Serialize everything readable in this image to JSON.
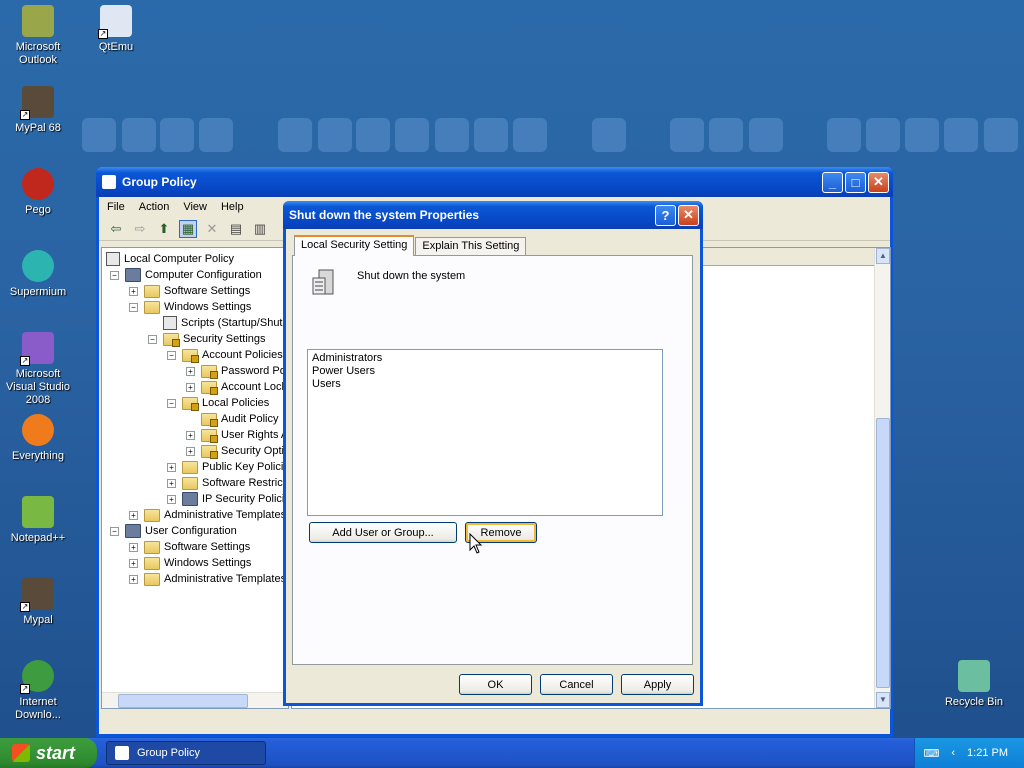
{
  "desktop": {
    "icons": [
      {
        "label": "Microsoft Outlook",
        "color": "#9aa64a"
      },
      {
        "label": "QtEmu",
        "color": "#dfe7f2"
      },
      {
        "label": "MyPal 68",
        "color": "#5a4a3a"
      },
      {
        "label": "Pego",
        "color": "#c0281e"
      },
      {
        "label": "Supermium",
        "color": "#2cb5b0"
      },
      {
        "label": "Microsoft Visual Studio 2008",
        "color": "#8a5cc9"
      },
      {
        "label": "Everything",
        "color": "#ef7b1d"
      },
      {
        "label": "Notepad++",
        "color": "#79b843"
      },
      {
        "label": "Mypal",
        "color": "#5a4a3a"
      },
      {
        "label": "Internet Downlo...",
        "color": "#3f9b3f"
      },
      {
        "label": "Recycle Bin",
        "color": "#6bbfa0"
      }
    ]
  },
  "group_policy": {
    "title": "Group Policy",
    "menu": [
      "File",
      "Action",
      "View",
      "Help"
    ],
    "tree": [
      {
        "label": "Local Computer Policy"
      },
      {
        "label": "Computer Configuration"
      },
      {
        "label": "Software Settings"
      },
      {
        "label": "Windows Settings"
      },
      {
        "label": "Scripts (Startup/Shutdown)"
      },
      {
        "label": "Security Settings"
      },
      {
        "label": "Account Policies"
      },
      {
        "label": "Password Policy"
      },
      {
        "label": "Account Lockout Policy"
      },
      {
        "label": "Local Policies"
      },
      {
        "label": "Audit Policy"
      },
      {
        "label": "User Rights Assignment"
      },
      {
        "label": "Security Options"
      },
      {
        "label": "Public Key Policies"
      },
      {
        "label": "Software Restriction Policies"
      },
      {
        "label": "IP Security Policies on Local Computer"
      },
      {
        "label": "Administrative Templates"
      },
      {
        "label": "User Configuration"
      },
      {
        "label": "Software Settings"
      },
      {
        "label": "Windows Settings"
      },
      {
        "label": "Administrative Templates"
      }
    ]
  },
  "dialog": {
    "title": "Shut down the system Properties",
    "help_label": "?",
    "close_label": "✕",
    "tabs": [
      "Local Security Setting",
      "Explain This Setting"
    ],
    "policy_name": "Shut down the system",
    "members": [
      "Administrators",
      "Power Users",
      "Users"
    ],
    "add_button": "Add User or Group...",
    "remove_button": "Remove",
    "ok_button": "OK",
    "cancel_button": "Cancel",
    "apply_button": "Apply"
  },
  "taskbar": {
    "start_label": "start",
    "task_item": "Group Policy",
    "clock": "1:21 PM",
    "tray_chevron": "‹"
  }
}
